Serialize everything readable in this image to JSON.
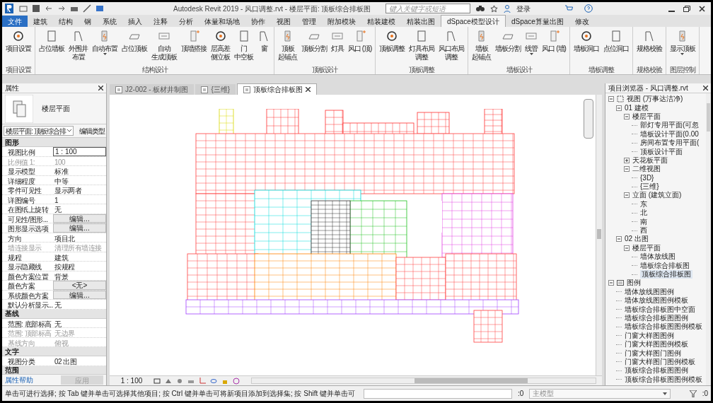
{
  "title_bar": {
    "title": "Autodesk Revit 2019 - 风口调整.rvt - 楼层平面: 顶板综合排板图",
    "search_placeholder": "键入关键字或短语",
    "sign_in": "登录"
  },
  "ribbon_tabs": [
    {
      "label": "文件",
      "kind": "file",
      "selected": false
    },
    {
      "label": "建筑",
      "kind": "tab",
      "selected": false
    },
    {
      "label": "结构",
      "kind": "tab",
      "selected": false
    },
    {
      "label": "钢",
      "kind": "tab",
      "selected": false
    },
    {
      "label": "系统",
      "kind": "tab",
      "selected": false
    },
    {
      "label": "插入",
      "kind": "tab",
      "selected": false
    },
    {
      "label": "注释",
      "kind": "tab",
      "selected": false
    },
    {
      "label": "分析",
      "kind": "tab",
      "selected": false
    },
    {
      "label": "体量和场地",
      "kind": "tab",
      "selected": false
    },
    {
      "label": "协作",
      "kind": "tab",
      "selected": false
    },
    {
      "label": "视图",
      "kind": "tab",
      "selected": false
    },
    {
      "label": "管理",
      "kind": "tab",
      "selected": false
    },
    {
      "label": "附加模块",
      "kind": "tab",
      "selected": false
    },
    {
      "label": "精装建模",
      "kind": "tab",
      "selected": false
    },
    {
      "label": "精装出图",
      "kind": "tab",
      "selected": false
    },
    {
      "label": "dSpace模型设计",
      "kind": "tab",
      "selected": true
    },
    {
      "label": "dSpace算量出图",
      "kind": "tab",
      "selected": false
    },
    {
      "label": "修改",
      "kind": "tab",
      "selected": false
    }
  ],
  "ribbon_panels": [
    {
      "title": "项目设置",
      "buttons": [
        {
          "label": "项目设置",
          "dropdown": false
        }
      ]
    },
    {
      "title": "结构设计",
      "buttons": [
        {
          "label": "占位墙板",
          "dropdown": false
        },
        {
          "label": [
            "外围井",
            "布置"
          ],
          "dropdown": false
        },
        {
          "label": "自动布置",
          "dropdown": true
        },
        {
          "label": "占位顶板",
          "dropdown": false
        },
        {
          "label": [
            "自动",
            "生成顶板"
          ],
          "dropdown": false
        },
        {
          "label": "顶墙搭接",
          "dropdown": false
        },
        {
          "label": [
            "层高差",
            "侧立板"
          ],
          "dropdown": false
        },
        {
          "label": [
            "门",
            "中空板"
          ],
          "dropdown": false
        },
        {
          "label": "窗",
          "dropdown": false
        }
      ]
    },
    {
      "title": "顶板设计",
      "buttons": [
        {
          "label": [
            "顶板",
            "起铺点"
          ],
          "dropdown": false
        },
        {
          "label": "顶板分割",
          "dropdown": false
        },
        {
          "label": "灯具",
          "dropdown": false
        },
        {
          "label": "风口 (顶)",
          "dropdown": false
        }
      ]
    },
    {
      "title": "顶板调整",
      "buttons": [
        {
          "label": "顶板调整",
          "dropdown": false
        },
        {
          "label": [
            "灯具布局",
            "调整"
          ],
          "dropdown": false
        },
        {
          "label": [
            "风口布局",
            "调整"
          ],
          "dropdown": false
        }
      ]
    },
    {
      "title": "墙板设计",
      "buttons": [
        {
          "label": [
            "墙板",
            "起铺点"
          ],
          "dropdown": false
        },
        {
          "label": "墙板分割",
          "dropdown": false
        },
        {
          "label": "线管",
          "dropdown": true
        },
        {
          "label": "风口 (墙)",
          "dropdown": false
        }
      ]
    },
    {
      "title": "墙板调整",
      "buttons": [
        {
          "label": "墙板洞口",
          "dropdown": false
        },
        {
          "label": "点位洞口",
          "dropdown": false
        }
      ]
    },
    {
      "title": "规格校验",
      "buttons": [
        {
          "label": "规格校验",
          "dropdown": false
        }
      ]
    },
    {
      "title": "图层控制",
      "buttons": [
        {
          "label": "显示顶板",
          "dropdown": true
        }
      ]
    }
  ],
  "properties": {
    "title": "属性",
    "type_name": "楼层平面",
    "selector": "楼层平面: 顶板综合排",
    "edit_type": "编辑类型",
    "sections": [
      {
        "title": "图形",
        "rows": [
          {
            "label": "视图比例",
            "value": "1 : 100",
            "kind": "input",
            "disabled": false
          },
          {
            "label": "比例值 1:",
            "value": "100",
            "kind": "text",
            "disabled": true
          },
          {
            "label": "显示模型",
            "value": "标准",
            "kind": "text",
            "disabled": false
          },
          {
            "label": "详细程度",
            "value": "中等",
            "kind": "text",
            "disabled": false
          },
          {
            "label": "零件可见性",
            "value": "显示两者",
            "kind": "text",
            "disabled": false
          },
          {
            "label": "详图编号",
            "value": "1",
            "kind": "text",
            "disabled": false
          },
          {
            "label": "在图纸上旋转",
            "value": "无",
            "kind": "text",
            "disabled": false
          },
          {
            "label": "可见性/图形...",
            "value": "编辑...",
            "kind": "button",
            "disabled": false
          },
          {
            "label": "图形显示选项",
            "value": "编辑...",
            "kind": "button",
            "disabled": false
          },
          {
            "label": "方向",
            "value": "项目北",
            "kind": "text",
            "disabled": false
          },
          {
            "label": "墙连接显示",
            "value": "清理所有墙连接",
            "kind": "text",
            "disabled": true
          },
          {
            "label": "规程",
            "value": "建筑",
            "kind": "text",
            "disabled": false
          },
          {
            "label": "显示隐藏线",
            "value": "按规程",
            "kind": "text",
            "disabled": false
          },
          {
            "label": "颜色方案位置",
            "value": "背景",
            "kind": "text",
            "disabled": false
          },
          {
            "label": "颜色方案",
            "value": "<无>",
            "kind": "button",
            "disabled": false
          },
          {
            "label": "系统颜色方案",
            "value": "编辑...",
            "kind": "button",
            "disabled": false
          },
          {
            "label": "默认分析显示...",
            "value": "无",
            "kind": "text",
            "disabled": false
          }
        ]
      },
      {
        "title": "基线",
        "rows": [
          {
            "label": "范围: 底部标高",
            "value": "无",
            "kind": "text",
            "disabled": false
          },
          {
            "label": "范围: 顶部标高",
            "value": "无边界",
            "kind": "text",
            "disabled": true
          },
          {
            "label": "基线方向",
            "value": "俯视",
            "kind": "text",
            "disabled": true
          }
        ]
      },
      {
        "title": "文字",
        "rows": [
          {
            "label": "视图分类",
            "value": "02 出图",
            "kind": "text",
            "disabled": false
          }
        ]
      },
      {
        "title": "范围"
      }
    ],
    "help_link": "属性帮助",
    "apply": {
      "label": "应用",
      "disabled": true
    }
  },
  "view_tabs": [
    {
      "label": "J2-002 - 板材井制图",
      "selected": false
    },
    {
      "label": "{三维}",
      "selected": false
    },
    {
      "label": "顶板综合排板图",
      "selected": true
    }
  ],
  "view_scale": "1 : 100",
  "project_browser": {
    "title": "项目浏览器 - 风口调整.rvt",
    "tree": [
      {
        "label": "视图 (万事达洁净)",
        "kind": "views",
        "expanded": true,
        "selected": false,
        "children": [
          {
            "label": "01 建模",
            "expanded": true,
            "selected": false,
            "children": [
              {
                "label": "楼层平面",
                "expanded": true,
                "selected": false,
                "children": [
                  {
                    "label": "部灯专用平面(可忽",
                    "selected": false
                  },
                  {
                    "label": "墙板设计平面(0.00",
                    "selected": false
                  },
                  {
                    "label": "房间布置专用平面(",
                    "selected": false
                  },
                  {
                    "label": "顶板设计平面",
                    "selected": false
                  }
                ]
              },
              {
                "label": "天花板平面",
                "expanded": false,
                "selected": false
              },
              {
                "label": "二维视图",
                "expanded": true,
                "selected": false,
                "children": [
                  {
                    "label": "{3D}",
                    "selected": false
                  },
                  {
                    "label": "{三维}",
                    "selected": false
                  }
                ]
              },
              {
                "label": "立面 (建筑立面)",
                "expanded": true,
                "selected": false,
                "children": [
                  {
                    "label": "东",
                    "selected": false
                  },
                  {
                    "label": "北",
                    "selected": false
                  },
                  {
                    "label": "南",
                    "selected": false
                  },
                  {
                    "label": "西",
                    "selected": false
                  }
                ]
              }
            ]
          },
          {
            "label": "02 出图",
            "expanded": true,
            "selected": false,
            "children": [
              {
                "label": "楼层平面",
                "expanded": true,
                "selected": false,
                "children": [
                  {
                    "label": "墙体放线图",
                    "selected": false
                  },
                  {
                    "label": "墙板综合排板图",
                    "selected": false
                  },
                  {
                    "label": "顶板综合排板图",
                    "selected": true
                  }
                ]
              }
            ]
          }
        ]
      },
      {
        "label": "图例",
        "kind": "legends",
        "expanded": true,
        "selected": false,
        "children": [
          {
            "label": "墙体放线图图例",
            "selected": false
          },
          {
            "label": "墙体放线图图例模板",
            "selected": false
          },
          {
            "label": "墙板综合排板图中空面",
            "selected": false
          },
          {
            "label": "墙板综合排板图图例",
            "selected": false
          },
          {
            "label": "墙板综合排板图图例模板",
            "selected": false
          },
          {
            "label": "门窗大样图图例",
            "selected": false
          },
          {
            "label": "门窗大样图图例模板",
            "selected": false
          },
          {
            "label": "门窗大样图门图例",
            "selected": false
          },
          {
            "label": "门窗大样图门图例模板",
            "selected": false
          },
          {
            "label": "顶板综合排板图图例",
            "selected": false
          },
          {
            "label": "顶板综合排板图图例模板",
            "selected": false
          }
        ]
      }
    ]
  },
  "status_bar": {
    "message": "单击可进行选择; 按 Tab 键并单击可选择其他项目; 按 Ctrl 键并单击可将新项目添加到选择集; 按 Shift 键并单击可",
    "selection_count": ":0",
    "model": "主模型",
    "filter_count": ":0"
  }
}
